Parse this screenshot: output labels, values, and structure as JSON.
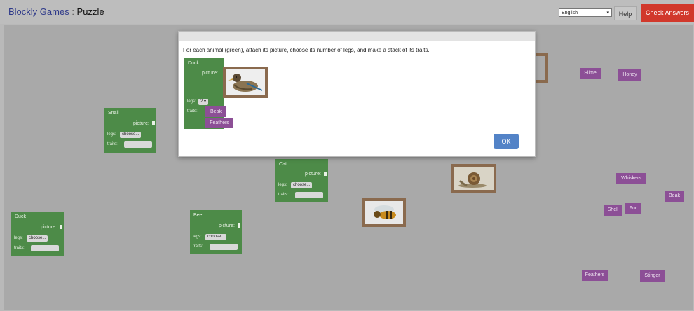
{
  "header": {
    "app_name": "Blockly Games",
    "separator": " : ",
    "game_name": "Puzzle",
    "language_selected": "English",
    "help_label": "Help",
    "check_label": "Check Answers"
  },
  "dialog": {
    "instructions": "For each animal (green), attach its picture, choose its number of legs, and make a stack of its traits.",
    "ok_label": "OK",
    "example": {
      "name": "Duck",
      "picture_label": "picture:",
      "legs_label": "legs:",
      "legs_value": "2",
      "traits_label": "traits:",
      "traits": [
        "Beak",
        "Feathers"
      ]
    }
  },
  "animals": [
    {
      "name": "Snail",
      "picture_label": "picture:",
      "legs_label": "legs:",
      "legs_value": "choose...",
      "traits_label": "traits:"
    },
    {
      "name": "Cat",
      "picture_label": "picture:",
      "legs_label": "legs:",
      "legs_value": "choose...",
      "traits_label": "traits:"
    },
    {
      "name": "Duck",
      "picture_label": "picture:",
      "legs_label": "legs:",
      "legs_value": "choose...",
      "traits_label": "traits:"
    },
    {
      "name": "Bee",
      "picture_label": "picture:",
      "legs_label": "legs:",
      "legs_value": "choose...",
      "traits_label": "traits:"
    }
  ],
  "traits": [
    "Slime",
    "Honey",
    "Whiskers",
    "Beak",
    "Shell",
    "Fur",
    "Feathers",
    "Stinger"
  ],
  "pictures": [
    "snail-picture",
    "bee-picture",
    "duck-picture"
  ]
}
